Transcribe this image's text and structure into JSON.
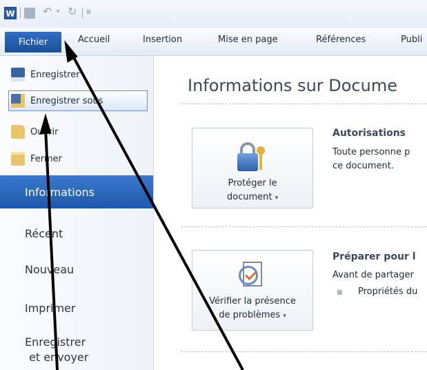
{
  "tabs": {
    "file": "Fichier",
    "home": "Accueil",
    "insert": "Insertion",
    "layout": "Mise en page",
    "references": "Références",
    "mailings": "Publi"
  },
  "commands": [
    "Enregistrer",
    "Enregistrer sous",
    "Ouvrir",
    "Fermer"
  ],
  "nav": {
    "info": "Informations",
    "recent": "Récent",
    "new": "Nouveau",
    "print": "Imprimer",
    "share_line1": "Enregistrer",
    "share_line2": "et envoyer"
  },
  "main": {
    "title": "Informations sur Docume",
    "protect_button": [
      "Protéger le",
      "document"
    ],
    "permissions_heading": "Autorisations",
    "permissions_text": [
      "Toute personne p",
      "ce document."
    ],
    "check_button": [
      "Vérifier la présence",
      "de problèmes"
    ],
    "prepare_heading": "Préparer pour l",
    "prepare_text": "Avant de partager",
    "prepare_bullet": "Propriétés du"
  },
  "colors": {
    "file_tab": "#1f5ba8",
    "active_nav": "#2a68bd",
    "annotation_arrows": "#000000"
  }
}
